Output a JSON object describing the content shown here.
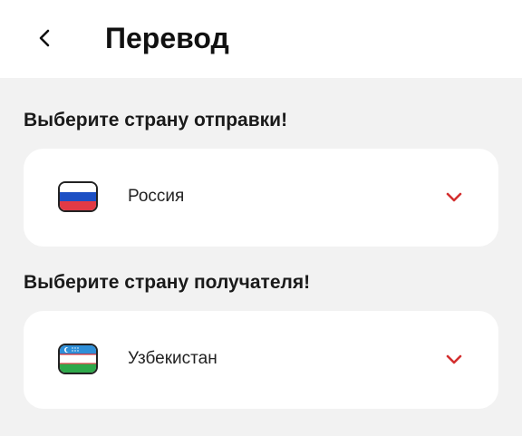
{
  "header": {
    "title": "Перевод",
    "back_icon": "chevron-left-icon"
  },
  "sender": {
    "label": "Выберите страну отправки!",
    "country": "Россия",
    "flag_icon": "russia-flag-icon",
    "chevron_icon": "chevron-down-icon"
  },
  "recipient": {
    "label": "Выберите страну получателя!",
    "country": "Узбекистан",
    "flag_icon": "uzbekistan-flag-icon",
    "chevron_icon": "chevron-down-icon"
  },
  "colors": {
    "accent": "#d32f2f",
    "background": "#f2f2f2",
    "card": "#ffffff"
  }
}
